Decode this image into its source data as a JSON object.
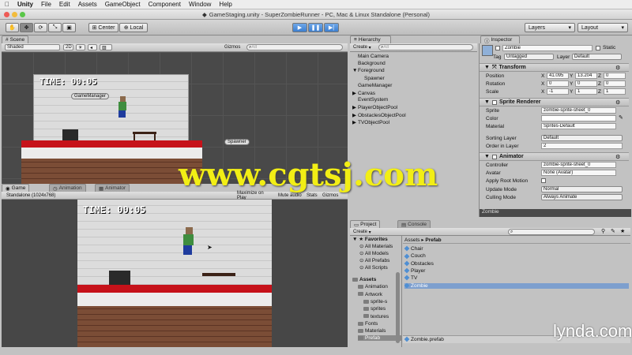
{
  "menubar": {
    "apple": "",
    "app": "Unity",
    "items": [
      "File",
      "Edit",
      "Assets",
      "GameObject",
      "Component",
      "Window",
      "Help"
    ]
  },
  "window_title": "GameStaging.unity - SuperZombieRunner - PC, Mac & Linux Standalone (Personal)",
  "toolbar": {
    "center": "Center",
    "local": "Local",
    "layers": "Layers",
    "layout": "Layout"
  },
  "scene": {
    "tab": "Scene",
    "shading": "Shaded",
    "mode2d": "2D",
    "gizmos": "Gizmos",
    "search": "All",
    "timer": "TIME: 00:05",
    "label_gm": "GameManager",
    "label_spawner": "Spawner"
  },
  "game": {
    "tabs": [
      "Game",
      "Animation",
      "Animator"
    ],
    "resolution": "Standalone (1024x768)",
    "maximize": "Maximize on Play",
    "mute": "Mute audio",
    "stats": "Stats",
    "gizmos": "Gizmos",
    "timer": "TIME: 00:05"
  },
  "hierarchy": {
    "tab": "Hierarchy",
    "create": "Create",
    "search": "All",
    "items": [
      {
        "label": "Main Camera",
        "indent": 0,
        "arrow": ""
      },
      {
        "label": "Background",
        "indent": 0,
        "arrow": ""
      },
      {
        "label": "Foreground",
        "indent": 0,
        "arrow": "▼"
      },
      {
        "label": "Spawner",
        "indent": 1,
        "arrow": ""
      },
      {
        "label": "GameManager",
        "indent": 0,
        "arrow": ""
      },
      {
        "label": "Canvas",
        "indent": 0,
        "arrow": "▶"
      },
      {
        "label": "EventSystem",
        "indent": 0,
        "arrow": ""
      },
      {
        "label": "PlayerObjectPool",
        "indent": 0,
        "arrow": "▶"
      },
      {
        "label": "ObstaclesObjectPool",
        "indent": 0,
        "arrow": "▶"
      },
      {
        "label": "TVObjectPool",
        "indent": 0,
        "arrow": "▶"
      }
    ]
  },
  "inspector": {
    "tab": "Inspector",
    "name": "Zombie",
    "static": "Static",
    "tag_label": "Tag",
    "tag": "Untagged",
    "layer_label": "Layer",
    "layer": "Default",
    "transform": {
      "title": "Transform",
      "position": "Position",
      "rotation": "Rotation",
      "scale": "Scale",
      "pos": [
        "41.095",
        "13.204",
        "0"
      ],
      "rot": [
        "0",
        "0",
        "0"
      ],
      "scl": [
        "-1",
        "1",
        "1"
      ]
    },
    "sprite_renderer": {
      "title": "Sprite Renderer",
      "sprite_label": "Sprite",
      "sprite": "zombie-sprite-sheet_0",
      "color_label": "Color",
      "material_label": "Material",
      "material": "Sprites-Default",
      "sorting_label": "Sorting Layer",
      "sorting": "Default",
      "order_label": "Order in Layer",
      "order": "2"
    },
    "animator": {
      "title": "Animator",
      "controller_label": "Controller",
      "controller": "zombie-sprite-sheet_0",
      "avatar_label": "Avatar",
      "avatar": "None (Avatar)",
      "root_label": "Apply Root Motion",
      "update_label": "Update Mode",
      "update": "Normal",
      "culling_label": "Culling Mode",
      "culling": "Always Animate"
    },
    "preview": "Zombie"
  },
  "project": {
    "tabs": [
      "Project",
      "Console"
    ],
    "create": "Create",
    "breadcrumb": [
      "Assets",
      "Prefab"
    ],
    "favorites": [
      "Favorites",
      "All Materials",
      "All Models",
      "All Prefabs",
      "All Scripts"
    ],
    "tree": [
      "Assets",
      "Animation",
      "Artwork",
      "sprite-s",
      "sprites",
      "textures",
      "Fonts",
      "Materials",
      "Prefab"
    ],
    "assets": [
      "Chair",
      "Couch",
      "Obstacles",
      "Player",
      "TV",
      "Zombie"
    ],
    "selected_file": "Zombie.prefab"
  },
  "watermark": "www.cgtsj.com",
  "brand": "lynda.com"
}
